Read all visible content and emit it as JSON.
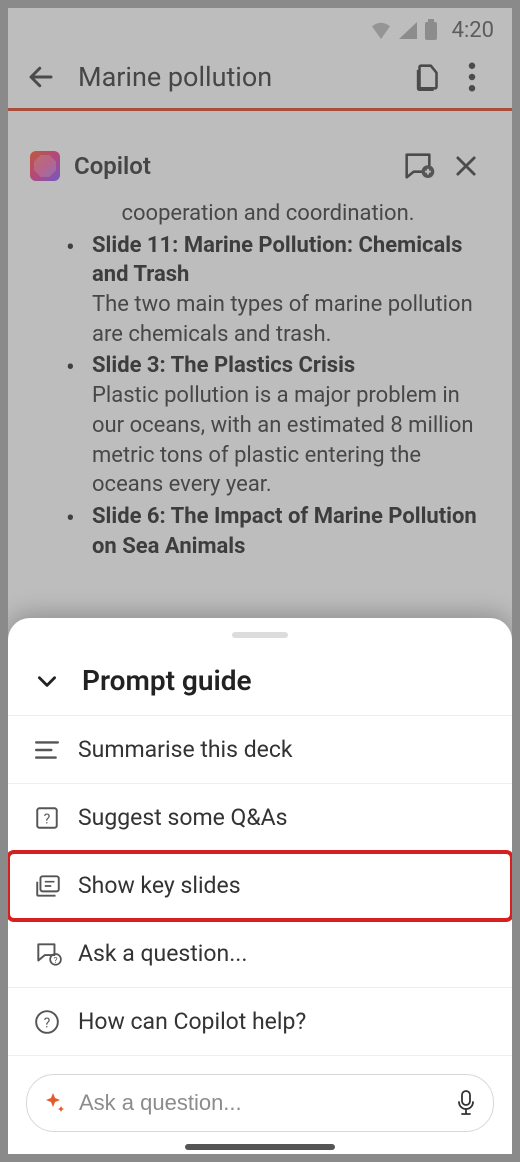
{
  "status": {
    "time": "4:20"
  },
  "header": {
    "title": "Marine pollution"
  },
  "copilot": {
    "title": "Copilot",
    "partial_line": "cooperation and coordination.",
    "items": [
      {
        "title": "Slide 11: Marine Pollution: Chemicals and Trash",
        "body": "The two main types of marine pollution are chemicals and trash."
      },
      {
        "title": "Slide 3: The Plastics Crisis",
        "body": "Plastic pollution is a major problem in our oceans, with an estimated 8 million metric tons of plastic entering the oceans every year."
      },
      {
        "title": "Slide 6: The Impact of Marine Pollution on Sea Animals",
        "body": ""
      }
    ]
  },
  "sheet": {
    "title": "Prompt guide",
    "menu": {
      "summarise": "Summarise this deck",
      "qas": "Suggest some Q&As",
      "keyslides": "Show key slides",
      "ask": "Ask a question...",
      "help": "How can Copilot help?"
    },
    "input_placeholder": "Ask a question..."
  }
}
